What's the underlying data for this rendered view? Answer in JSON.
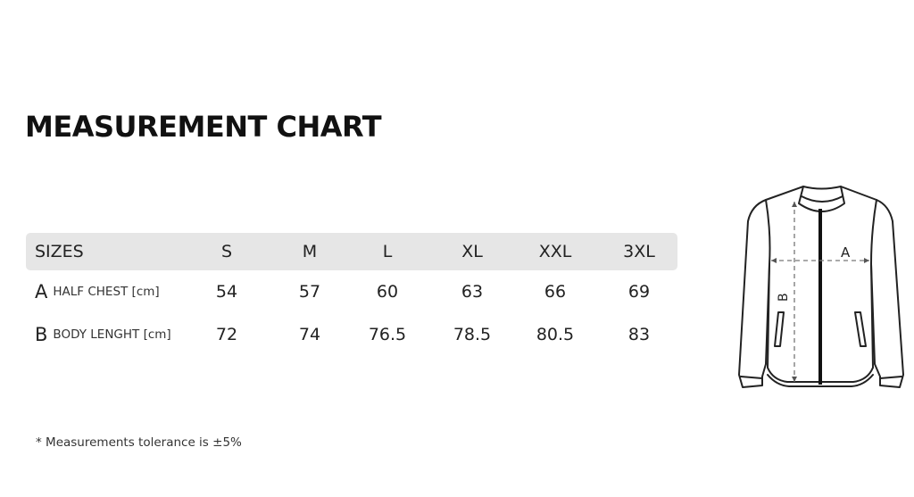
{
  "title": "MEASUREMENT CHART",
  "table": {
    "header": {
      "label": "SIZES",
      "sizes": [
        "S",
        "M",
        "L",
        "XL",
        "XXL",
        "3XL"
      ]
    },
    "rows": [
      {
        "letter": "A",
        "name": "HALF CHEST [cm]",
        "values": [
          "54",
          "57",
          "60",
          "63",
          "66",
          "69"
        ]
      },
      {
        "letter": "B",
        "name": "BODY LENGHT [cm]",
        "values": [
          "72",
          "74",
          "76.5",
          "78.5",
          "80.5",
          "83"
        ]
      }
    ]
  },
  "note": "* Measurements tolerance is ±5%",
  "diagram": {
    "icon": "jacket-icon",
    "label_a": "A",
    "label_b": "B"
  }
}
